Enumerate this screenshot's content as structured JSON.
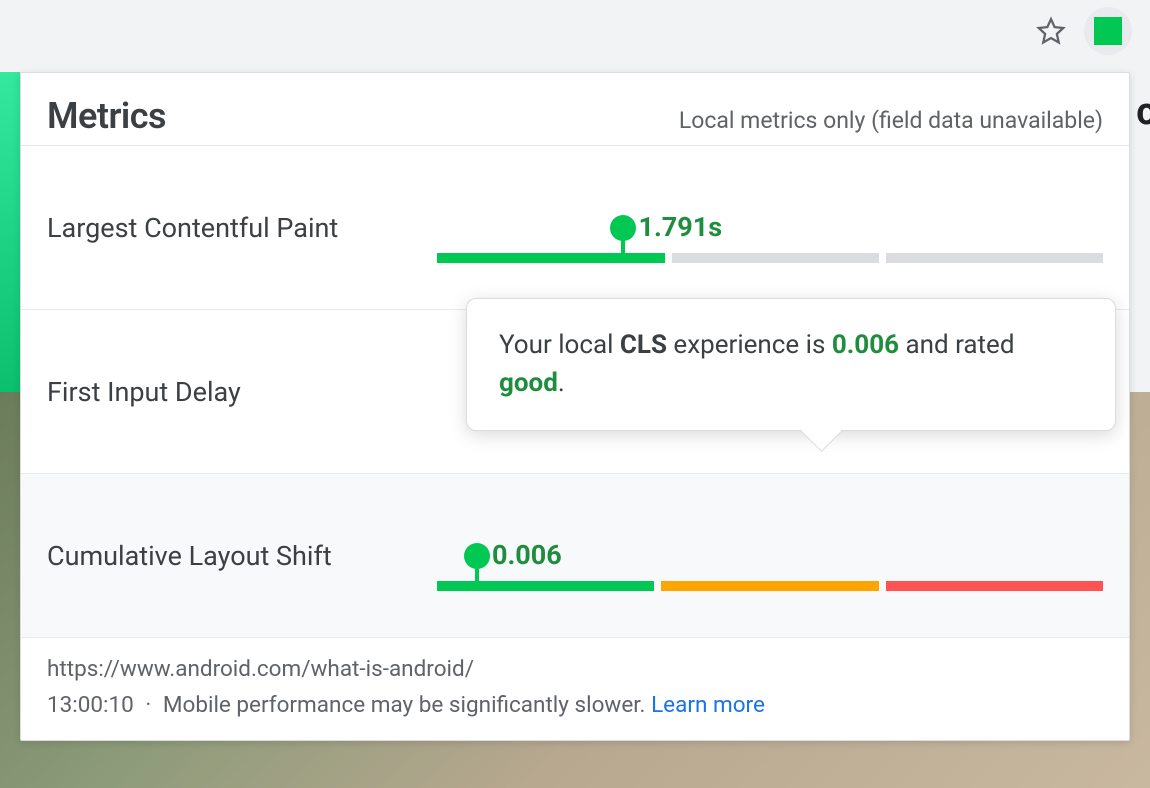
{
  "colors": {
    "good": "#00c853",
    "ni": "orange",
    "poor": "#ff5252",
    "link": "#1a73e8"
  },
  "omnibox": {
    "star_icon": "star-icon",
    "extension_badge": "web-vitals-extension"
  },
  "panel": {
    "title": "Metrics",
    "subtitle": "Local metrics only (field data unavailable)",
    "metrics": [
      {
        "key": "lcp",
        "label": "Largest Contentful Paint",
        "value_text": "1.791s",
        "marker_percent": 28,
        "segments": [
          "good",
          "grey",
          "grey"
        ],
        "highlighted": false
      },
      {
        "key": "fid",
        "label": "First Input Delay",
        "value_text": "",
        "marker_percent": null,
        "segments": [],
        "highlighted": false
      },
      {
        "key": "cls",
        "label": "Cumulative Layout Shift",
        "value_text": "0.006",
        "marker_percent": 6,
        "segments": [
          "good",
          "ni",
          "poor"
        ],
        "highlighted": true
      }
    ],
    "tooltip": {
      "lead": "Your local ",
      "metric_abbr": "CLS",
      "mid": " experience is ",
      "value": "0.006",
      "tail": " and rated ",
      "rating": "good",
      "end": "."
    },
    "footer": {
      "url": "https://www.android.com/what-is-android/",
      "timestamp": "13:00:10",
      "sep": "·",
      "note": "Mobile performance may be significantly slower.",
      "learn_more": "Learn more"
    }
  }
}
